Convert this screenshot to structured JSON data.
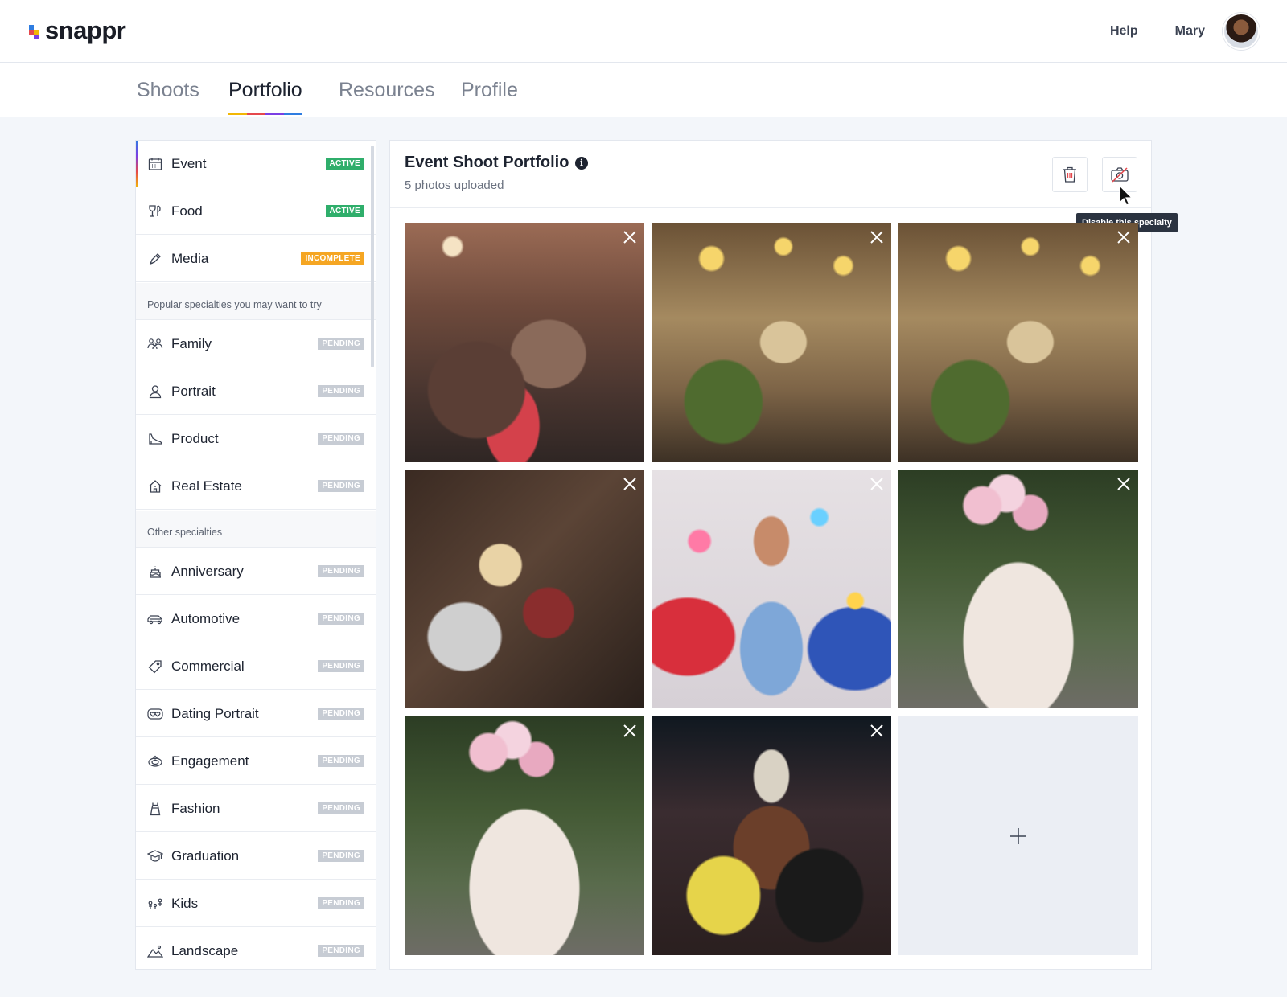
{
  "brand": {
    "name": "snappr"
  },
  "header": {
    "help": "Help",
    "user_name": "Mary"
  },
  "tabs": [
    {
      "label": "Shoots",
      "active": false
    },
    {
      "label": "Portfolio",
      "active": true
    },
    {
      "label": "Resources",
      "active": false
    },
    {
      "label": "Profile",
      "active": false
    }
  ],
  "sidebar": {
    "active_items": [
      {
        "label": "Event",
        "status": "ACTIVE",
        "icon": "calendar-icon"
      },
      {
        "label": "Food",
        "status": "ACTIVE",
        "icon": "wine-glass-icon"
      },
      {
        "label": "Media",
        "status": "INCOMPLETE",
        "icon": "pen-icon"
      }
    ],
    "popular_heading": "Popular specialties you may want to try",
    "popular_items": [
      {
        "label": "Family",
        "status": "PENDING",
        "icon": "family-icon"
      },
      {
        "label": "Portrait",
        "status": "PENDING",
        "icon": "person-icon"
      },
      {
        "label": "Product",
        "status": "PENDING",
        "icon": "shoe-icon"
      },
      {
        "label": "Real Estate",
        "status": "PENDING",
        "icon": "house-icon"
      }
    ],
    "other_heading": "Other specialties",
    "other_items": [
      {
        "label": "Anniversary",
        "status": "PENDING",
        "icon": "cake-icon"
      },
      {
        "label": "Automotive",
        "status": "PENDING",
        "icon": "car-icon"
      },
      {
        "label": "Commercial",
        "status": "PENDING",
        "icon": "tag-icon"
      },
      {
        "label": "Dating Portrait",
        "status": "PENDING",
        "icon": "hearts-icon"
      },
      {
        "label": "Engagement",
        "status": "PENDING",
        "icon": "ring-icon"
      },
      {
        "label": "Fashion",
        "status": "PENDING",
        "icon": "dress-icon"
      },
      {
        "label": "Graduation",
        "status": "PENDING",
        "icon": "graduation-cap-icon"
      },
      {
        "label": "Kids",
        "status": "PENDING",
        "icon": "kids-icon"
      },
      {
        "label": "Landscape",
        "status": "PENDING",
        "icon": "mountain-icon"
      }
    ]
  },
  "portfolio": {
    "title": "Event Shoot Portfolio",
    "subtitle": "5 photos uploaded",
    "tooltip": "Disable this specialty",
    "photos": [
      "party-crowd",
      "toast-glasses",
      "toast-glasses",
      "wine-clink",
      "confetti-friends",
      "balloon-group",
      "balloon-group",
      "night-friends"
    ]
  },
  "colors": {
    "active": "#2fae6b",
    "incomplete": "#f5a623",
    "pending": "#c7ccd4"
  }
}
